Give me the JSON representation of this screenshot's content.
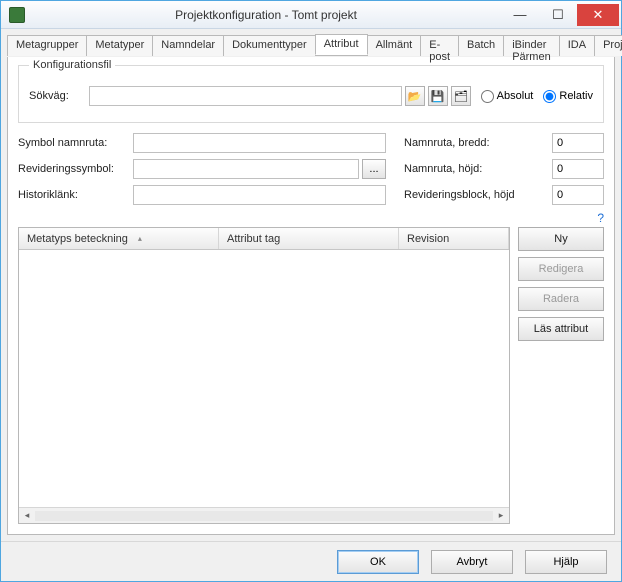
{
  "window": {
    "title": "Projektkonfiguration - Tomt projekt"
  },
  "tabs": {
    "items": [
      "Metagrupper",
      "Metatyper",
      "Namndelar",
      "Dokumenttyper",
      "Attribut",
      "Allmänt",
      "E-post",
      "Batch",
      "iBinder Pärmen",
      "IDA",
      "ProjectWise"
    ],
    "active_index": 4
  },
  "config": {
    "fieldset_label": "Konfigurationsfil",
    "path_label": "Sökväg:",
    "path_value": "",
    "icons": {
      "open": "folder-open-icon",
      "save": "save-icon",
      "saveas": "save-in-icon"
    },
    "radio_absolute": "Absolut",
    "radio_relative": "Relativ",
    "radio_selected": "relative"
  },
  "left_fields": {
    "symbol_label": "Symbol namnruta:",
    "symbol_value": "",
    "rev_label": "Revideringssymbol:",
    "rev_value": "",
    "hist_label": "Historiklänk:",
    "hist_value": "",
    "browse_dots": "..."
  },
  "right_fields": {
    "width_label": "Namnruta, bredd:",
    "width_value": "0",
    "height_label": "Namnruta, höjd:",
    "height_value": "0",
    "revblock_label": "Revideringsblock, höjd",
    "revblock_value": "0"
  },
  "grid": {
    "columns": [
      "Metatyps beteckning",
      "Attribut tag",
      "Revision"
    ],
    "sort_col": 0,
    "rows": []
  },
  "side_buttons": {
    "new": "Ny",
    "edit": "Redigera",
    "delete": "Radera",
    "read": "Läs attribut"
  },
  "footer": {
    "ok": "OK",
    "cancel": "Avbryt",
    "help": "Hjälp"
  },
  "help_icon": "?"
}
